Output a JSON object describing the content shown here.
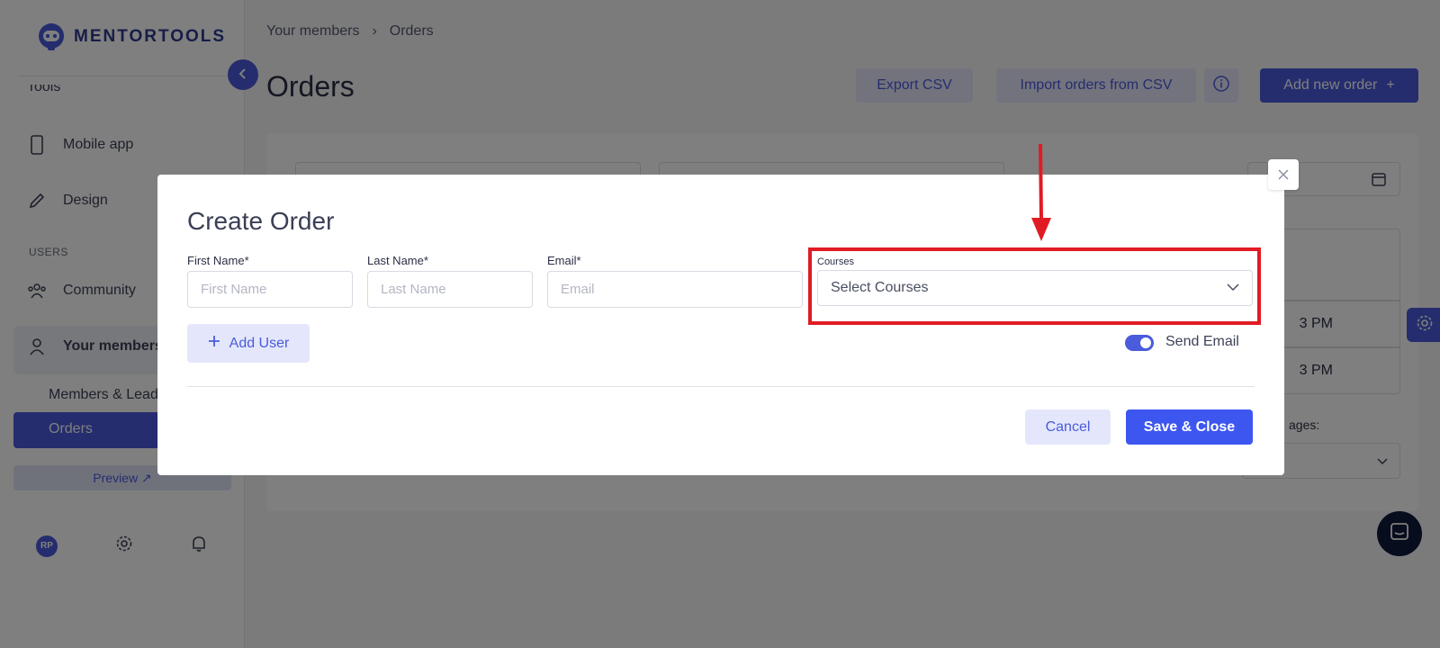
{
  "brand": {
    "name": "MENTORTOOLS"
  },
  "sidebar": {
    "top_cut_label": "Tools",
    "items": [
      {
        "label": "Mobile app",
        "icon": "mobile-icon"
      },
      {
        "label": "Design",
        "icon": "pencil-icon"
      }
    ],
    "section_label": "USERS",
    "users_items": [
      {
        "label": "Community",
        "icon": "community-icon"
      },
      {
        "label": "Your members",
        "icon": "user-icon"
      }
    ],
    "sub_items": [
      {
        "label": "Members & Leads"
      },
      {
        "label": "Orders"
      }
    ],
    "preview_label": "Preview ↗",
    "avatar_initials": "RP"
  },
  "header": {
    "breadcrumb": [
      "Your members",
      "Orders"
    ],
    "title": "Orders",
    "export_label": "Export CSV",
    "import_label": "Import orders from CSV",
    "add_label": "Add new order"
  },
  "background": {
    "row_times": [
      "3 PM",
      "3 PM"
    ],
    "pages_label": "ages:"
  },
  "modal": {
    "title": "Create Order",
    "first_name": {
      "label": "First Name",
      "required": "*",
      "placeholder": "First Name",
      "value": ""
    },
    "last_name": {
      "label": "Last Name",
      "required": "*",
      "placeholder": "Last Name",
      "value": ""
    },
    "email": {
      "label": "Email",
      "required": "*",
      "placeholder": "Email",
      "value": ""
    },
    "courses": {
      "label": "Courses",
      "placeholder": "Select Courses"
    },
    "add_user_label": "Add User",
    "send_email_label": "Send Email",
    "send_email_enabled": true,
    "cancel_label": "Cancel",
    "save_label": "Save & Close"
  },
  "colors": {
    "accent": "#4a5bdc",
    "primary_button": "#3d56f0",
    "annotation": "#e01b24"
  }
}
